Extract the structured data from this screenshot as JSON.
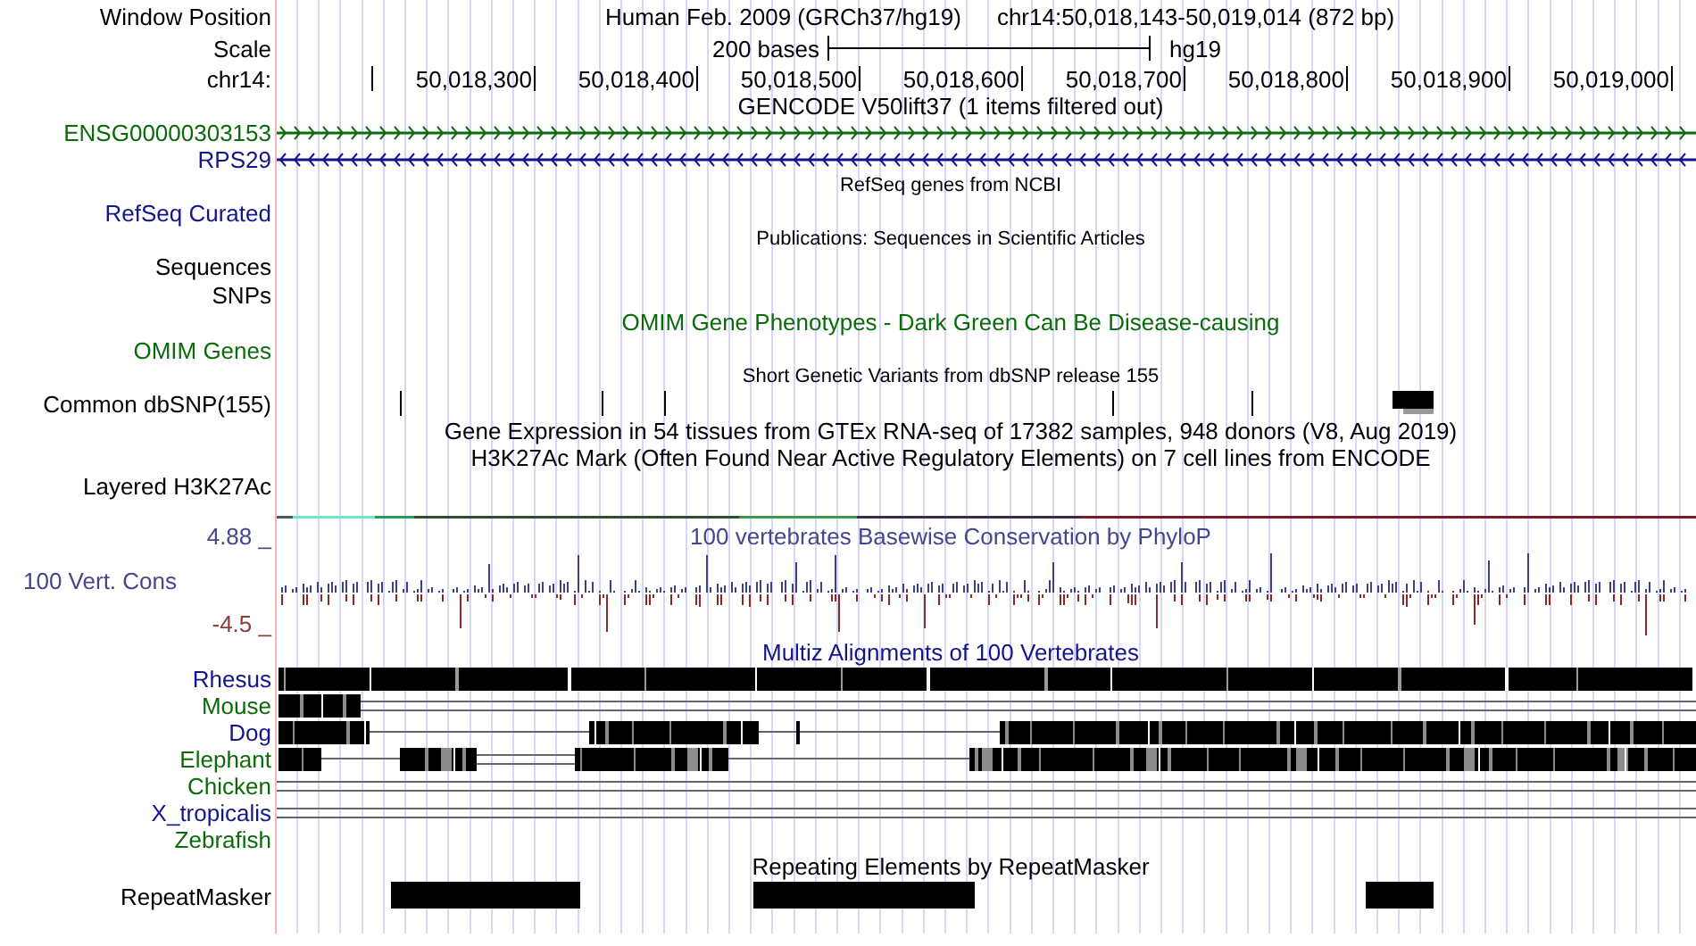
{
  "position": {
    "label": "Window Position",
    "title": "Human Feb. 2009 (GRCh37/hg19)",
    "location": "chr14:50,018,143-50,019,014 (872 bp)"
  },
  "scale": {
    "label": "Scale",
    "bases": "200 bases",
    "assembly": "hg19"
  },
  "ruler": {
    "label": "chr14:",
    "ticks": [
      "50,018,300",
      "50,018,400",
      "50,018,500",
      "50,018,600",
      "50,018,700",
      "50,018,800",
      "50,018,900",
      "50,019,000"
    ]
  },
  "tracks": [
    {
      "kind": "title",
      "text": "GENCODE V50lift37 (1 items filtered out)"
    },
    {
      "kind": "gene",
      "label": "ENSG00000303153",
      "color": "#0b6b0b",
      "forward": true
    },
    {
      "kind": "gene",
      "label": "RPS29",
      "color": "#14148c",
      "forward": false
    },
    {
      "kind": "small-title",
      "text": "RefSeq genes from NCBI"
    },
    {
      "kind": "label",
      "label": "RefSeq Curated",
      "color": "#14148c"
    },
    {
      "kind": "small-title",
      "text": "Publications: Sequences in Scientific Articles"
    },
    {
      "kind": "label",
      "label": "Sequences"
    },
    {
      "kind": "label",
      "label": "SNPs"
    },
    {
      "kind": "title",
      "text": "OMIM Gene Phenotypes - Dark Green Can Be Disease-causing",
      "color": "#0b6b0b"
    },
    {
      "kind": "label",
      "label": "OMIM Genes",
      "color": "#0b6b0b"
    },
    {
      "kind": "small-title",
      "text": "Short Genetic Variants from dbSNP release 155"
    },
    {
      "kind": "snps",
      "label": "Common dbSNP(155)"
    },
    {
      "kind": "title",
      "text": "Gene Expression in 54 tissues from GTEx RNA-seq of 17382 samples, 948 donors (V8, Aug 2019)"
    },
    {
      "kind": "title",
      "text": "H3K27Ac Mark (Often Found Near Active Regulatory Elements) on 7 cell lines from ENCODE"
    },
    {
      "kind": "label",
      "label": "Layered H3K27Ac"
    },
    {
      "kind": "signal-line"
    },
    {
      "kind": "wiggle",
      "title": "100 vertebrates Basewise Conservation by PhyloP",
      "label": "100 Vert. Cons",
      "max": "4.88 _",
      "min": "-4.5 _"
    },
    {
      "kind": "title",
      "text": "Multiz Alignments of 100 Vertebrates",
      "color": "#14148c"
    },
    {
      "kind": "alignment",
      "label": "Rhesus",
      "color": "#14148c"
    },
    {
      "kind": "alignment",
      "label": "Mouse",
      "color": "#0b6b0b"
    },
    {
      "kind": "alignment",
      "label": "Dog",
      "color": "#14148c"
    },
    {
      "kind": "alignment",
      "label": "Elephant",
      "color": "#0b6b0b"
    },
    {
      "kind": "alignment",
      "label": "Chicken",
      "color": "#0b6b0b"
    },
    {
      "kind": "alignment",
      "label": "X_tropicalis",
      "color": "#14148c"
    },
    {
      "kind": "alignment",
      "label": "Zebrafish",
      "color": "#0b6b0b"
    },
    {
      "kind": "title",
      "text": "Repeating Elements by RepeatMasker"
    },
    {
      "kind": "repeats",
      "label": "RepeatMasker"
    }
  ]
}
